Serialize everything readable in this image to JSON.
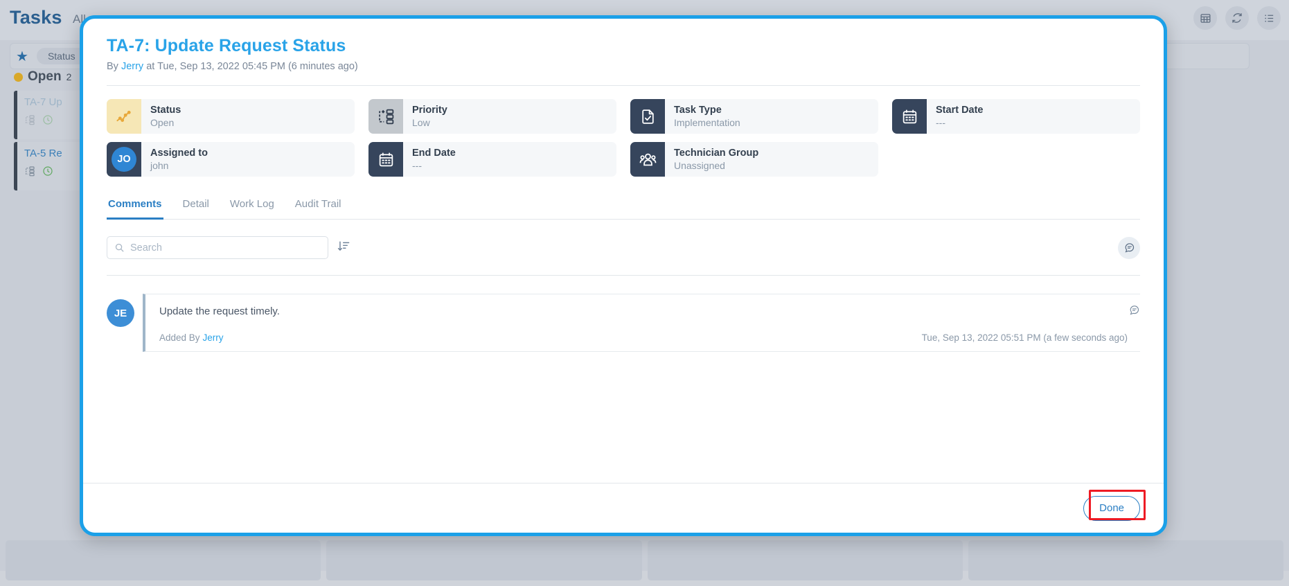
{
  "background": {
    "title": "Tasks",
    "secondary_nav": "All",
    "filter_pill": "Status",
    "group": {
      "label": "Open",
      "count": "2",
      "dot_color": "#d9a829"
    },
    "tasks": [
      {
        "title": "TA-7 Up",
        "icons": [
          "workflow-icon",
          "clock-icon"
        ]
      },
      {
        "title": "TA-5 Re",
        "icons": [
          "workflow-icon",
          "clock-icon"
        ]
      }
    ],
    "top_icons": [
      "table-grid-icon",
      "refresh-icon",
      "list-view-icon"
    ]
  },
  "modal": {
    "title": "TA-7: Update Request Status",
    "subtitle_prefix": "By",
    "subtitle_author": "Jerry",
    "subtitle_suffix": "at Tue, Sep 13, 2022 05:45 PM (6 minutes ago)",
    "accent_color": "#1ba0e8",
    "cards": [
      {
        "label": "Status",
        "value": "Open",
        "icon": "line-chart-icon",
        "icon_style": "yellow"
      },
      {
        "label": "Priority",
        "value": "Low",
        "icon": "priority-flow-icon",
        "icon_style": "grey"
      },
      {
        "label": "Task Type",
        "value": "Implementation",
        "icon": "document-check-icon",
        "icon_style": "dark"
      },
      {
        "label": "Start Date",
        "value": "---",
        "icon": "calendar-icon",
        "icon_style": "dark"
      },
      {
        "label": "Assigned to",
        "value": "john",
        "icon": "avatar-icon",
        "icon_style": "dark",
        "avatar_initials": "JO"
      },
      {
        "label": "End Date",
        "value": "---",
        "icon": "calendar-icon",
        "icon_style": "dark"
      },
      {
        "label": "Technician Group",
        "value": "Unassigned",
        "icon": "people-group-icon",
        "icon_style": "dark"
      }
    ],
    "tabs": [
      {
        "label": "Comments",
        "active": true
      },
      {
        "label": "Detail",
        "active": false
      },
      {
        "label": "Work Log",
        "active": false
      },
      {
        "label": "Audit Trail",
        "active": false
      }
    ],
    "search": {
      "value": "",
      "placeholder": "Search"
    },
    "comments": [
      {
        "initials": "JE",
        "text": "Update the request timely.",
        "added_by_label": "Added By",
        "author": "Jerry",
        "timestamp": "Tue, Sep 13, 2022 05:51 PM (a few seconds ago)"
      }
    ],
    "footer": {
      "done_label": "Done"
    },
    "highlight_color": "#ee1b24"
  }
}
